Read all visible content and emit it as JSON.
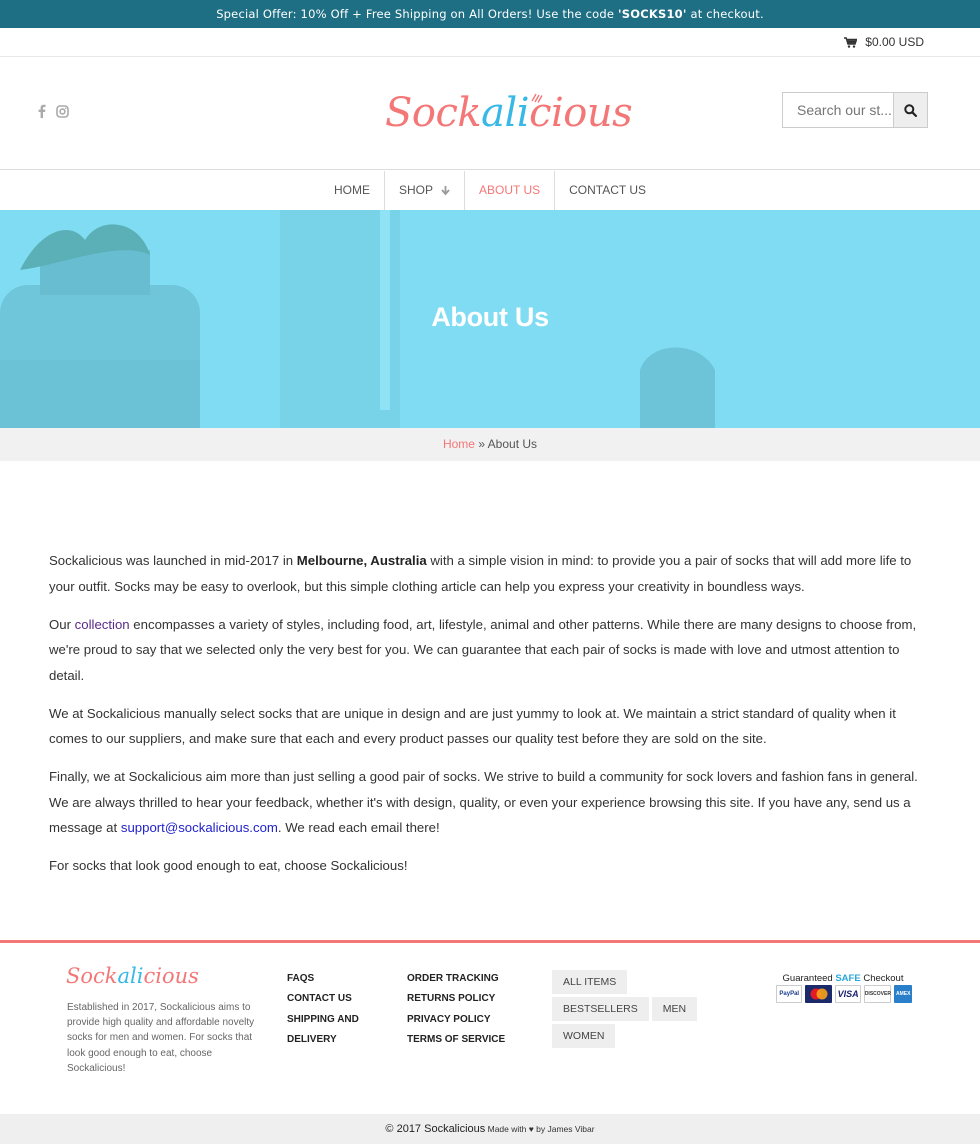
{
  "announcement": {
    "text_before": "Special Offer: 10% Off + Free Shipping on All Orders! Use the code ",
    "code": "'SOCKS10'",
    "text_after": " at checkout."
  },
  "cart": {
    "icon": "shopping-cart-icon",
    "amount": "$0.00 USD"
  },
  "social": {
    "icons": [
      "facebook-icon",
      "instagram-icon"
    ]
  },
  "brand": {
    "logo_part1": "Sock",
    "logo_part2": "ali",
    "logo_part3": "cious",
    "color_pink": "#f47778",
    "color_blue": "#38b8e5"
  },
  "search": {
    "placeholder": "Search our st..."
  },
  "nav": {
    "items": [
      {
        "label": "HOME"
      },
      {
        "label": "SHOP"
      },
      {
        "label": "ABOUT US"
      },
      {
        "label": "CONTACT US"
      }
    ]
  },
  "hero": {
    "title": "About Us"
  },
  "breadcrumb": {
    "home": "Home",
    "separator": " » ",
    "current": "About Us"
  },
  "content": {
    "p1_a": "Sockalicious was launched in mid-2017 in ",
    "p1_bold": "Melbourne, Australia",
    "p1_b": " with a simple vision in mind: to provide you a pair of socks that will add more life to your outfit. Socks may be easy to overlook, but this simple clothing article can help you express your creativity in boundless ways.",
    "p2_a": "Our ",
    "p2_link": "collection",
    "p2_b": " encompasses a variety of styles, including food, art, lifestyle, animal and other patterns. While there are many designs to choose from, we're proud to say that we selected only the very best for you. We can guarantee that each pair of socks is made with love and utmost attention to detail.",
    "p3": "We at Sockalicious manually select socks that are unique in design and are just yummy to look at. We maintain a strict standard of quality when it comes to our suppliers, and make sure that each and every product passes our quality test before they are sold on the site.",
    "p4_a": "Finally, we at Sockalicious aim more than just selling a good pair of socks. We strive to build a community for sock lovers and fashion fans in general. We are always thrilled to hear your feedback, whether it's with design, quality, or even your experience browsing this site. If you have any, send us a message at ",
    "p4_link": "support@sockalicious.com",
    "p4_b": ". We read each email there!",
    "p5": "For socks that look good enough to eat, choose Sockalicious!"
  },
  "footer": {
    "about": "Established in 2017, Sockalicious aims to provide high quality and affordable novelty socks for men and women. For socks that look good enough to eat, choose Sockalicious!",
    "col1": [
      "FAQS",
      "CONTACT US",
      "SHIPPING AND DELIVERY"
    ],
    "col2": [
      "ORDER TRACKING",
      "RETURNS POLICY",
      "PRIVACY POLICY",
      "TERMS OF SERVICE"
    ],
    "tags": [
      "ALL ITEMS",
      "BESTSELLERS",
      "MEN",
      "WOMEN"
    ],
    "secure": {
      "prefix": "Guaranteed ",
      "safe": "SAFE",
      "suffix": " Checkout"
    },
    "cards": [
      "PayPal",
      "MasterCard",
      "VISA",
      "DISCOVER",
      "AMEX"
    ]
  },
  "bottom": {
    "copyright": "© 2017 Sockalicious",
    "made_with": " Made with ",
    "heart": "♥",
    "by": " by James Vibar"
  }
}
